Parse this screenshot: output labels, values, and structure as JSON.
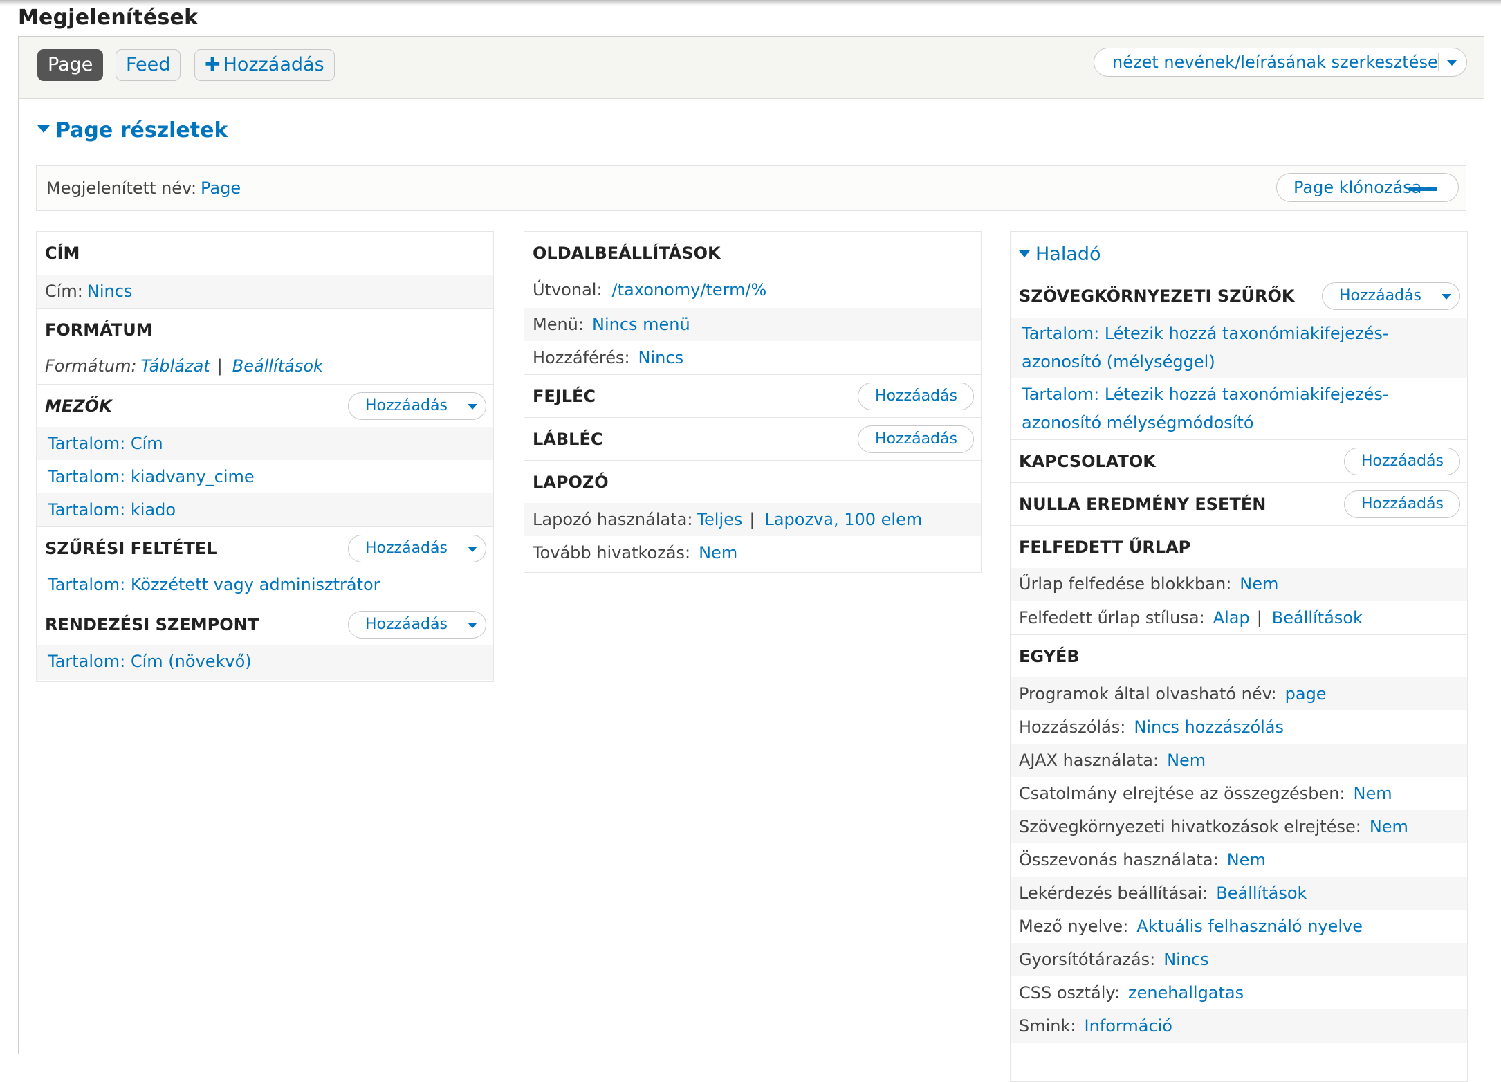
{
  "page_title": "Megjelenítések",
  "tabs": {
    "page": "Page",
    "feed": "Feed",
    "add_plus": "✚",
    "add": "Hozzáadás",
    "edit_name": "nézet nevének/leírásának szerkesztése"
  },
  "details": {
    "toggle": "Page részletek",
    "display_name_label": "Megjelenített név:",
    "display_name_value": "Page",
    "clone_button": "Page klónozása"
  },
  "col1": {
    "title_heading": "CÍM",
    "title_label": "Cím:",
    "title_value": "Nincs",
    "format_heading": "FORMÁTUM",
    "format_label": "Formátum:",
    "format_value": "Táblázat",
    "format_sep": "|",
    "format_settings": "Beállítások",
    "fields_heading": "MEZŐK",
    "fields": [
      "Tartalom: Cím",
      "Tartalom: kiadvany_cime",
      "Tartalom: kiado"
    ],
    "filter_heading": "SZŰRÉSI FELTÉTEL",
    "filters": [
      "Tartalom: Közzétett vagy adminisztrátor"
    ],
    "sort_heading": "RENDEZÉSI SZEMPONT",
    "sorts": [
      "Tartalom: Cím (növekvő)"
    ]
  },
  "col2": {
    "page_settings_heading": "OLDALBEÁLLÍTÁSOK",
    "path_label": "Útvonal:",
    "path_value": "/taxonomy/term/%",
    "menu_label": "Menü:",
    "menu_value": "Nincs menü",
    "access_label": "Hozzáférés:",
    "access_value": "Nincs",
    "header_heading": "FEJLÉC",
    "footer_heading": "LÁBLÉC",
    "pager_heading": "LAPOZÓ",
    "pager_label": "Lapozó használata:",
    "pager_value": "Teljes",
    "pager_sep": "|",
    "pager_value2": "Lapozva, 100 elem",
    "more_label": "Tovább hivatkozás:",
    "more_value": "Nem"
  },
  "col3": {
    "advanced_toggle": "Haladó",
    "contextual_heading": "SZÖVEGKÖRNYEZETI SZŰRŐK",
    "contextual_filters": [
      "Tartalom: Létezik hozzá taxonómiakifejezés-azonosító (mélységgel)",
      "Tartalom: Létezik hozzá taxonómiakifejezés-azonosító mélységmódosító"
    ],
    "relationships_heading": "KAPCSOLATOK",
    "no_results_heading": "NULLA EREDMÉNY ESETÉN",
    "exposed_heading": "FELFEDETT ŰRLAP",
    "exposed_block_label": "Űrlap felfedése blokkban:",
    "exposed_block_value": "Nem",
    "exposed_style_label": "Felfedett űrlap stílusa:",
    "exposed_style_value": "Alap",
    "exposed_style_sep": "|",
    "exposed_style_settings": "Beállítások",
    "other_heading": "EGYÉB",
    "other_rows": [
      {
        "label": "Programok által olvasható név:",
        "value": "page"
      },
      {
        "label": "Hozzászólás:",
        "value": "Nincs hozzászólás"
      },
      {
        "label": "AJAX használata:",
        "value": "Nem"
      },
      {
        "label": "Csatolmány elrejtése az összegzésben:",
        "value": "Nem"
      },
      {
        "label": "Szövegkörnyezeti hivatkozások elrejtése:",
        "value": "Nem"
      },
      {
        "label": "Összevonás használata:",
        "value": "Nem"
      },
      {
        "label": "Lekérdezés beállításai:",
        "value": "Beállítások"
      },
      {
        "label": "Mező nyelve:",
        "value": "Aktuális felhasználó nyelve"
      },
      {
        "label": "Gyorsítótárazás:",
        "value": "Nincs"
      },
      {
        "label": "CSS osztály:",
        "value": "zenehallgatas"
      },
      {
        "label": "Smink:",
        "value": "Információ"
      }
    ]
  },
  "buttons": {
    "add": "Hozzáadás"
  },
  "colors": {
    "link": "#0074bd",
    "active_tab": "#555555",
    "alt_row": "#f6f6f6"
  }
}
